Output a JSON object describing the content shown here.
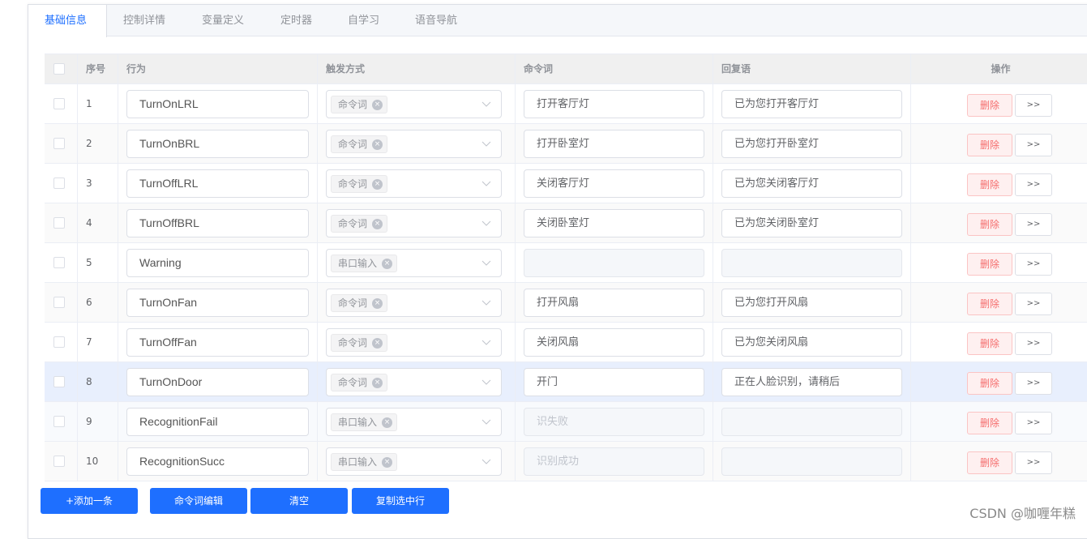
{
  "tabs": [
    {
      "label": "基础信息",
      "active": true
    },
    {
      "label": "控制详情",
      "active": false
    },
    {
      "label": "变量定义",
      "active": false
    },
    {
      "label": "定时器",
      "active": false
    },
    {
      "label": "自学习",
      "active": false
    },
    {
      "label": "语音导航",
      "active": false
    }
  ],
  "table": {
    "headers": {
      "index": "序号",
      "action": "行为",
      "trigger": "触发方式",
      "command": "命令词",
      "reply": "回复语",
      "operation": "操作"
    },
    "rows": [
      {
        "index": "1",
        "action": "TurnOnLRL",
        "trigger": "命令词",
        "command": "打开客厅灯",
        "reply": "已为您打开客厅灯",
        "disabled": false
      },
      {
        "index": "2",
        "action": "TurnOnBRL",
        "trigger": "命令词",
        "command": "打开卧室灯",
        "reply": "已为您打开卧室灯",
        "disabled": false
      },
      {
        "index": "3",
        "action": "TurnOffLRL",
        "trigger": "命令词",
        "command": "关闭客厅灯",
        "reply": "已为您关闭客厅灯",
        "disabled": false
      },
      {
        "index": "4",
        "action": "TurnOffBRL",
        "trigger": "命令词",
        "command": "关闭卧室灯",
        "reply": "已为您关闭卧室灯",
        "disabled": false
      },
      {
        "index": "5",
        "action": "Warning",
        "trigger": "串口输入",
        "command": "",
        "reply": "",
        "disabled": true
      },
      {
        "index": "6",
        "action": "TurnOnFan",
        "trigger": "命令词",
        "command": "打开风扇",
        "reply": "已为您打开风扇",
        "disabled": false
      },
      {
        "index": "7",
        "action": "TurnOffFan",
        "trigger": "命令词",
        "command": "关闭风扇",
        "reply": "已为您关闭风扇",
        "disabled": false
      },
      {
        "index": "8",
        "action": "TurnOnDoor",
        "trigger": "命令词",
        "command": "开门",
        "reply": "正在人脸识别，请稍后",
        "disabled": false
      },
      {
        "index": "9",
        "action": "RecognitionFail",
        "trigger": "串口输入",
        "command": "识失败",
        "reply": "",
        "disabled": true
      },
      {
        "index": "10",
        "action": "RecognitionSucc",
        "trigger": "串口输入",
        "command": "识别成功",
        "reply": "",
        "disabled": true
      }
    ],
    "delete_label": "删除",
    "more_label": ">>",
    "tag_close_glyph": "×"
  },
  "footer": {
    "add_label": "+添加一条",
    "edit_commands_label": "命令词编辑",
    "clear_label": "清空",
    "copy_selected_label": "复制选中行"
  },
  "watermark": "CSDN @咖喱年糕",
  "colors": {
    "primary": "#1e6fff",
    "danger": "#f56c6c",
    "hover_row": "#e8effd"
  }
}
